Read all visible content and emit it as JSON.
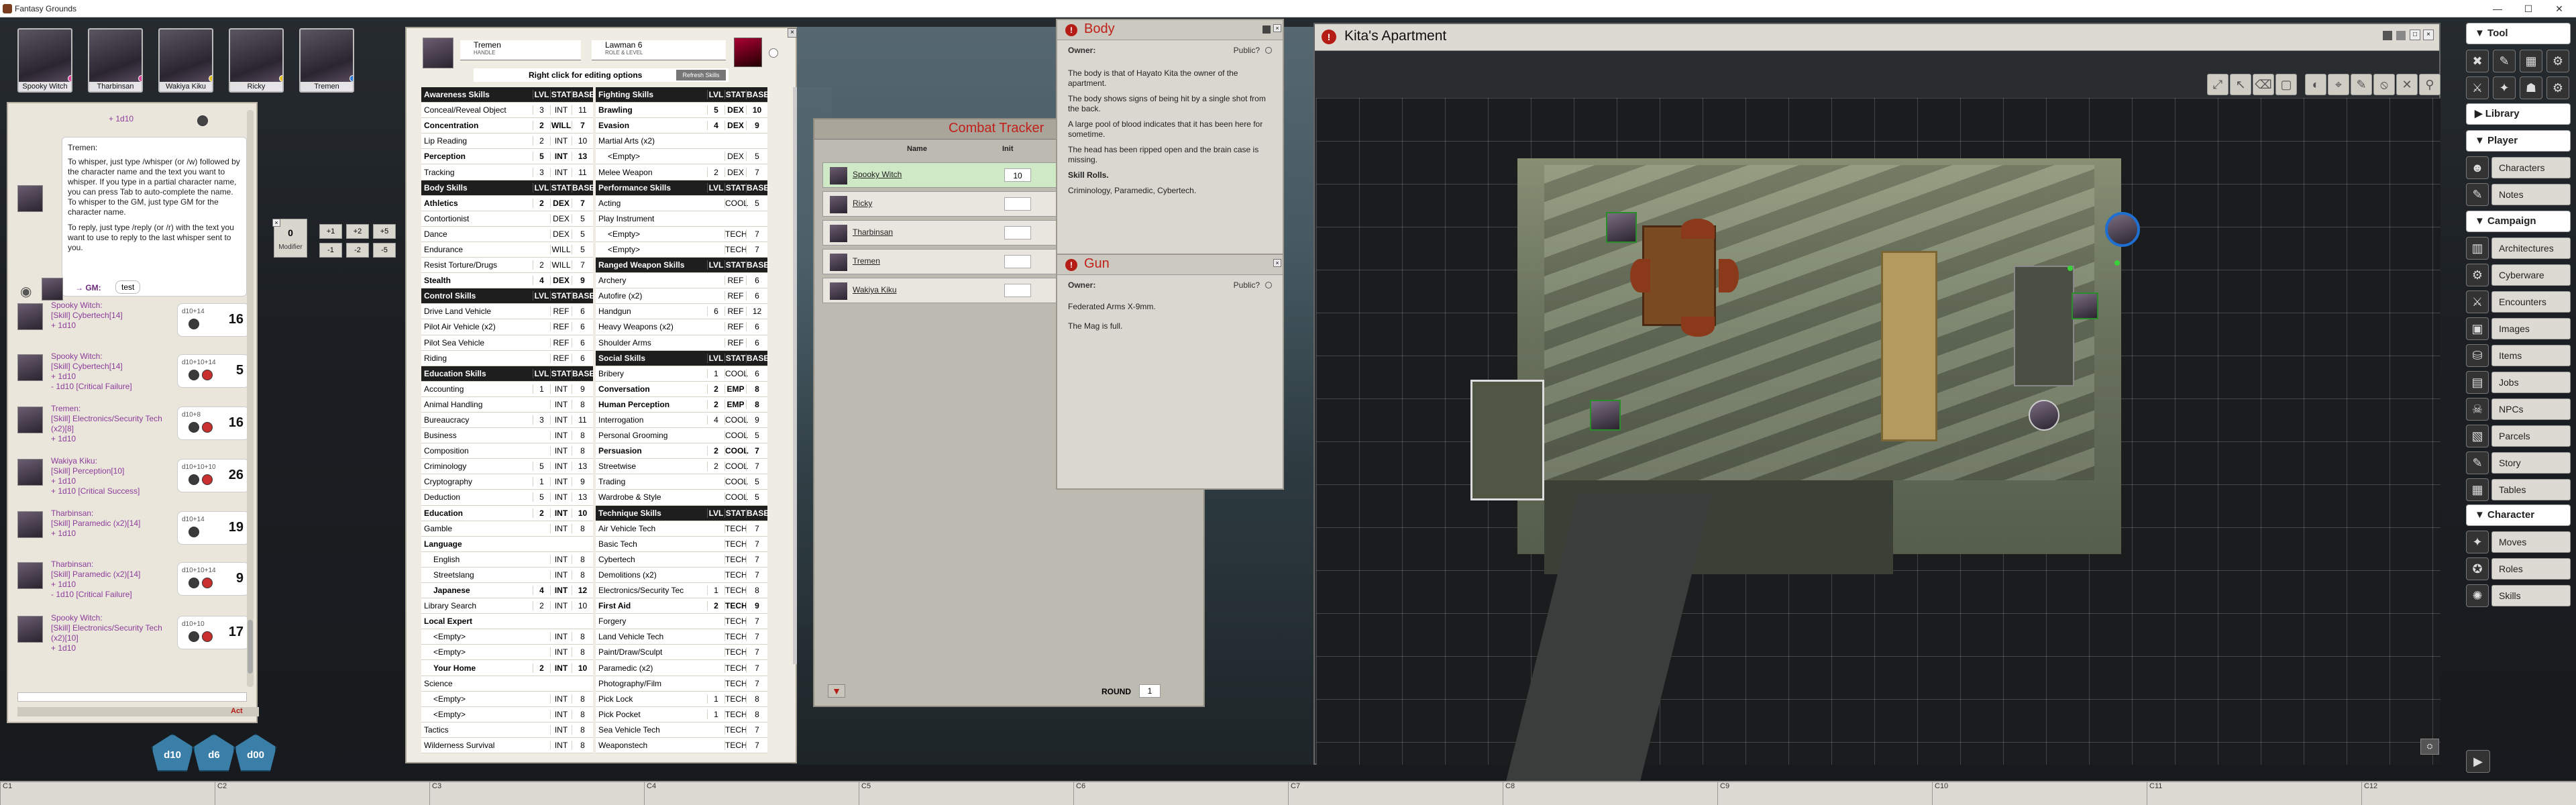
{
  "window": {
    "title": "Fantasy Grounds",
    "minimize": "—",
    "maximize": "☐",
    "close": "✕"
  },
  "party": [
    {
      "name": "Spooky Witch",
      "dot": "#e0449a"
    },
    {
      "name": "Tharbinsan",
      "dot": "#e0449a"
    },
    {
      "name": "Wakiya Kiku",
      "dot": "#e8c21d"
    },
    {
      "name": "Ricky",
      "dot": "#e8c21d"
    },
    {
      "name": "Tremen",
      "dot": "#2b7ee0"
    }
  ],
  "chat": {
    "top_roll": "+ 1d10",
    "whisper_sender": "Tremen:",
    "whisper_p1": "To whisper, just type /whisper (or /w) followed by the character name and the text you want to whisper. If you type in a partial character name, you can press Tab to auto-complete the name. To whisper to the GM, just type GM for the character name.",
    "whisper_p2": "To reply, just type /reply (or /r) with the text you want to use to reply to the last whisper sent to you.",
    "gm_label": "→ GM:",
    "gm_text": "test",
    "modifier": {
      "value": "0",
      "label": "Modifier"
    },
    "mod_buttons": [
      "+1",
      "+2",
      "+5",
      "-1",
      "-2",
      "-5"
    ],
    "input_action": "Act",
    "rolls": [
      {
        "lines": [
          "Spooky Witch:",
          "[Skill] Cybertech[14]",
          "+ 1d10"
        ],
        "expr": "d10+14",
        "total": "16"
      },
      {
        "lines": [
          "Spooky Witch:",
          "[Skill] Cybertech[14]",
          "+ 1d10",
          "- 1d10 [Critical Failure]"
        ],
        "expr": "d10+10+14",
        "total": "5"
      },
      {
        "lines": [
          "Tremen:",
          "[Skill] Electronics/Security Tech",
          "(x2)[8]",
          "+ 1d10"
        ],
        "expr": "d10+8",
        "total": "16"
      },
      {
        "lines": [
          "Wakiya Kiku:",
          "[Skill] Perception[10]",
          "+ 1d10",
          "+ 1d10 [Critical Success]"
        ],
        "expr": "d10+10+10",
        "total": "26"
      },
      {
        "lines": [
          "Tharbinsan:",
          "[Skill] Paramedic (x2)[14]",
          "+ 1d10"
        ],
        "expr": "d10+14",
        "total": "19"
      },
      {
        "lines": [
          "Tharbinsan:",
          "[Skill] Paramedic (x2)[14]",
          "+ 1d10",
          "- 1d10 [Critical Failure]"
        ],
        "expr": "d10+10+14",
        "total": "9"
      },
      {
        "lines": [
          "Spooky Witch:",
          "[Skill] Electronics/Security Tech",
          "(x2)[10]",
          "+ 1d10"
        ],
        "expr": "d10+10",
        "total": "17"
      }
    ]
  },
  "dice_tray": [
    "d10",
    "d6",
    "d00"
  ],
  "sheet": {
    "name_value": "Tremen",
    "name_label": "HANDLE",
    "role_value": "Lawman 6",
    "role_label": "ROLE & LEVEL",
    "hint": "Right click for editing options",
    "refresh": "Refresh Skills",
    "left_col": [
      {
        "t": "head",
        "n": "Awareness Skills",
        "l": "LVL",
        "s": "STAT",
        "b": "BASE"
      },
      {
        "n": "Conceal/Reveal Object",
        "l": "3",
        "s": "INT",
        "b": "11"
      },
      {
        "t": "grp",
        "n": "Concentration",
        "l": "2",
        "s": "WILL",
        "b": "7"
      },
      {
        "n": "Lip Reading",
        "l": "2",
        "s": "INT",
        "b": "10"
      },
      {
        "t": "grp",
        "n": "Perception",
        "l": "5",
        "s": "INT",
        "b": "13"
      },
      {
        "n": "Tracking",
        "l": "3",
        "s": "INT",
        "b": "11"
      },
      {
        "t": "head",
        "n": "Body Skills",
        "l": "LVL",
        "s": "STAT",
        "b": "BASE"
      },
      {
        "t": "grp",
        "n": "Athletics",
        "l": "2",
        "s": "DEX",
        "b": "7"
      },
      {
        "n": "Contortionist",
        "l": "",
        "s": "DEX",
        "b": "5"
      },
      {
        "n": "Dance",
        "l": "",
        "s": "DEX",
        "b": "5"
      },
      {
        "n": "Endurance",
        "l": "",
        "s": "WILL",
        "b": "5"
      },
      {
        "n": "Resist Torture/Drugs",
        "l": "2",
        "s": "WILL",
        "b": "7"
      },
      {
        "t": "grp",
        "n": "Stealth",
        "l": "4",
        "s": "DEX",
        "b": "9"
      },
      {
        "t": "head",
        "n": "Control Skills",
        "l": "LVL",
        "s": "STAT",
        "b": "BASE"
      },
      {
        "n": "Drive Land Vehicle",
        "l": "",
        "s": "REF",
        "b": "6"
      },
      {
        "n": "Pilot Air Vehicle (x2)",
        "l": "",
        "s": "REF",
        "b": "6"
      },
      {
        "n": "Pilot Sea Vehicle",
        "l": "",
        "s": "REF",
        "b": "6"
      },
      {
        "n": "Riding",
        "l": "",
        "s": "REF",
        "b": "6"
      },
      {
        "t": "head",
        "n": "Education Skills",
        "l": "LVL",
        "s": "STAT",
        "b": "BASE"
      },
      {
        "n": "Accounting",
        "l": "1",
        "s": "INT",
        "b": "9"
      },
      {
        "n": "Animal Handling",
        "l": "",
        "s": "INT",
        "b": "8"
      },
      {
        "n": "Bureaucracy",
        "l": "3",
        "s": "INT",
        "b": "11"
      },
      {
        "n": "Business",
        "l": "",
        "s": "INT",
        "b": "8"
      },
      {
        "n": "Composition",
        "l": "",
        "s": "INT",
        "b": "8"
      },
      {
        "n": "Criminology",
        "l": "5",
        "s": "INT",
        "b": "13"
      },
      {
        "n": "Cryptography",
        "l": "1",
        "s": "INT",
        "b": "9"
      },
      {
        "n": "Deduction",
        "l": "5",
        "s": "INT",
        "b": "13"
      },
      {
        "t": "grp",
        "n": "Education",
        "l": "2",
        "s": "INT",
        "b": "10"
      },
      {
        "n": "Gamble",
        "l": "",
        "s": "INT",
        "b": "8"
      },
      {
        "t": "grp",
        "n": "Language",
        "l": "",
        "s": "",
        "b": ""
      },
      {
        "n": "English",
        "l": "",
        "s": "INT",
        "b": "8",
        "ind": 1
      },
      {
        "n": "Streetslang",
        "l": "",
        "s": "INT",
        "b": "8",
        "ind": 1
      },
      {
        "t": "grp",
        "n": "Japanese",
        "l": "4",
        "s": "INT",
        "b": "12",
        "ind": 1
      },
      {
        "n": "Library Search",
        "l": "2",
        "s": "INT",
        "b": "10"
      },
      {
        "t": "grp",
        "n": "Local Expert",
        "l": "",
        "s": "",
        "b": ""
      },
      {
        "n": "<Empty>",
        "l": "",
        "s": "INT",
        "b": "8",
        "ind": 1
      },
      {
        "n": "<Empty>",
        "l": "",
        "s": "INT",
        "b": "8",
        "ind": 1
      },
      {
        "t": "grp",
        "n": "Your Home",
        "l": "2",
        "s": "INT",
        "b": "10",
        "ind": 1
      },
      {
        "n": "Science",
        "l": "",
        "s": "",
        "b": ""
      },
      {
        "n": "<Empty>",
        "l": "",
        "s": "INT",
        "b": "8",
        "ind": 1
      },
      {
        "n": "<Empty>",
        "l": "",
        "s": "INT",
        "b": "8",
        "ind": 1
      },
      {
        "n": "Tactics",
        "l": "",
        "s": "INT",
        "b": "8"
      },
      {
        "n": "Wilderness Survival",
        "l": "",
        "s": "INT",
        "b": "8"
      }
    ],
    "right_col": [
      {
        "t": "head",
        "n": "Fighting Skills",
        "l": "LVL",
        "s": "STAT",
        "b": "BASE"
      },
      {
        "t": "grp",
        "n": "Brawling",
        "l": "5",
        "s": "DEX",
        "b": "10"
      },
      {
        "t": "grp",
        "n": "Evasion",
        "l": "4",
        "s": "DEX",
        "b": "9"
      },
      {
        "n": "Martial Arts (x2)",
        "l": "",
        "s": "",
        "b": ""
      },
      {
        "n": "<Empty>",
        "l": "",
        "s": "DEX",
        "b": "5",
        "ind": 1
      },
      {
        "n": "Melee Weapon",
        "l": "2",
        "s": "DEX",
        "b": "7"
      },
      {
        "t": "head",
        "n": "Performance Skills",
        "l": "LVL",
        "s": "STAT",
        "b": "BASE"
      },
      {
        "n": "Acting",
        "l": "",
        "s": "COOL",
        "b": "5"
      },
      {
        "n": "Play Instrument",
        "l": "",
        "s": "",
        "b": ""
      },
      {
        "n": "<Empty>",
        "l": "",
        "s": "TECH",
        "b": "7",
        "ind": 1
      },
      {
        "n": "<Empty>",
        "l": "",
        "s": "TECH",
        "b": "7",
        "ind": 1
      },
      {
        "t": "head",
        "n": "Ranged Weapon Skills",
        "l": "LVL",
        "s": "STAT",
        "b": "BASE"
      },
      {
        "n": "Archery",
        "l": "",
        "s": "REF",
        "b": "6"
      },
      {
        "n": "Autofire (x2)",
        "l": "",
        "s": "REF",
        "b": "6"
      },
      {
        "n": "Handgun",
        "l": "6",
        "s": "REF",
        "b": "12"
      },
      {
        "n": "Heavy Weapons (x2)",
        "l": "",
        "s": "REF",
        "b": "6"
      },
      {
        "n": "Shoulder Arms",
        "l": "",
        "s": "REF",
        "b": "6"
      },
      {
        "t": "head",
        "n": "Social Skills",
        "l": "LVL",
        "s": "STAT",
        "b": "BASE"
      },
      {
        "n": "Bribery",
        "l": "1",
        "s": "COOL",
        "b": "6"
      },
      {
        "t": "grp",
        "n": "Conversation",
        "l": "2",
        "s": "EMP",
        "b": "8"
      },
      {
        "t": "grp",
        "n": "Human Perception",
        "l": "2",
        "s": "EMP",
        "b": "8"
      },
      {
        "n": "Interrogation",
        "l": "4",
        "s": "COOL",
        "b": "9"
      },
      {
        "n": "Personal Grooming",
        "l": "",
        "s": "COOL",
        "b": "5"
      },
      {
        "t": "grp",
        "n": "Persuasion",
        "l": "2",
        "s": "COOL",
        "b": "7"
      },
      {
        "n": "Streetwise",
        "l": "2",
        "s": "COOL",
        "b": "7"
      },
      {
        "n": "Trading",
        "l": "",
        "s": "COOL",
        "b": "5"
      },
      {
        "n": "Wardrobe & Style",
        "l": "",
        "s": "COOL",
        "b": "5"
      },
      {
        "t": "head",
        "n": "Technique Skills",
        "l": "LVL",
        "s": "STAT",
        "b": "BASE"
      },
      {
        "n": "Air Vehicle Tech",
        "l": "",
        "s": "TECH",
        "b": "7"
      },
      {
        "n": "Basic Tech",
        "l": "",
        "s": "TECH",
        "b": "7"
      },
      {
        "n": "Cybertech",
        "l": "",
        "s": "TECH",
        "b": "7"
      },
      {
        "n": "Demolitions (x2)",
        "l": "",
        "s": "TECH",
        "b": "7"
      },
      {
        "n": "Electronics/Security Tec",
        "l": "1",
        "s": "TECH",
        "b": "8"
      },
      {
        "t": "grp",
        "n": "First Aid",
        "l": "2",
        "s": "TECH",
        "b": "9"
      },
      {
        "n": "Forgery",
        "l": "",
        "s": "TECH",
        "b": "7"
      },
      {
        "n": "Land Vehicle Tech",
        "l": "",
        "s": "TECH",
        "b": "7"
      },
      {
        "n": "Paint/Draw/Sculpt",
        "l": "",
        "s": "TECH",
        "b": "7"
      },
      {
        "n": "Paramedic (x2)",
        "l": "",
        "s": "TECH",
        "b": "7"
      },
      {
        "n": "Photography/Film",
        "l": "",
        "s": "TECH",
        "b": "7"
      },
      {
        "n": "Pick Lock",
        "l": "1",
        "s": "TECH",
        "b": "8"
      },
      {
        "n": "Pick Pocket",
        "l": "1",
        "s": "TECH",
        "b": "8"
      },
      {
        "n": "Sea Vehicle Tech",
        "l": "",
        "s": "TECH",
        "b": "7"
      },
      {
        "n": "Weaponstech",
        "l": "",
        "s": "TECH",
        "b": "7"
      }
    ]
  },
  "combat_tracker": {
    "title": "Combat Tracker",
    "col_name": "Name",
    "col_init": "Init",
    "rows": [
      {
        "name": "Spooky Witch",
        "init": "10"
      },
      {
        "name": "Ricky",
        "init": ""
      },
      {
        "name": "Tharbinsan",
        "init": ""
      },
      {
        "name": "Tremen",
        "init": ""
      },
      {
        "name": "Wakiya Kiku",
        "init": ""
      }
    ],
    "round_label": "ROUND",
    "round_value": "1"
  },
  "note_body": {
    "title": "Body",
    "owner": "Owner:",
    "public": "Public?",
    "paras": [
      "The body is that of Hayato Kita the owner of the apartment.",
      "The body shows signs of being hit by a single shot from the back.",
      "A large pool of blood indicates that it has been here for sometime.",
      "The head has been ripped open and the brain case is missing."
    ],
    "rolls_label": "Skill Rolls.",
    "rolls_text": "Criminology, Paramedic, Cybertech."
  },
  "note_gun": {
    "title": "Gun",
    "owner": "Owner:",
    "public": "Public?",
    "paras": [
      "Federated Arms X-9mm.",
      "The Mag is full."
    ]
  },
  "map": {
    "title": "Kita's Apartment"
  },
  "sidebar": {
    "tool_header": "▼ Tool",
    "library_header": "▶ Library",
    "player_header": "▼ Player",
    "player_items": [
      "Characters",
      "Notes"
    ],
    "campaign_header": "▼ Campaign",
    "campaign_items": [
      "Architectures",
      "Cyberware",
      "Encounters",
      "Images",
      "Items",
      "Jobs",
      "NPCs",
      "Parcels",
      "Story",
      "Tables"
    ],
    "character_header": "▼ Character",
    "character_items": [
      "Moves",
      "Roles",
      "Skills"
    ]
  },
  "hotbar": [
    "C1",
    "C2",
    "C3",
    "C4",
    "C5",
    "C6",
    "C7",
    "C8",
    "C9",
    "C10",
    "C11",
    "C12"
  ]
}
